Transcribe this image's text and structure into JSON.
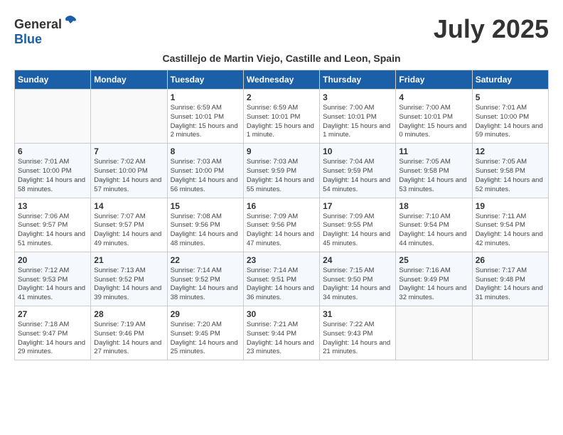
{
  "header": {
    "logo_general": "General",
    "logo_blue": "Blue",
    "month_title": "July 2025",
    "subtitle": "Castillejo de Martin Viejo, Castille and Leon, Spain"
  },
  "weekdays": [
    "Sunday",
    "Monday",
    "Tuesday",
    "Wednesday",
    "Thursday",
    "Friday",
    "Saturday"
  ],
  "weeks": [
    [
      {
        "day": "",
        "sunrise": "",
        "sunset": "",
        "daylight": ""
      },
      {
        "day": "",
        "sunrise": "",
        "sunset": "",
        "daylight": ""
      },
      {
        "day": "1",
        "sunrise": "Sunrise: 6:59 AM",
        "sunset": "Sunset: 10:01 PM",
        "daylight": "Daylight: 15 hours and 2 minutes."
      },
      {
        "day": "2",
        "sunrise": "Sunrise: 6:59 AM",
        "sunset": "Sunset: 10:01 PM",
        "daylight": "Daylight: 15 hours and 1 minute."
      },
      {
        "day": "3",
        "sunrise": "Sunrise: 7:00 AM",
        "sunset": "Sunset: 10:01 PM",
        "daylight": "Daylight: 15 hours and 1 minute."
      },
      {
        "day": "4",
        "sunrise": "Sunrise: 7:00 AM",
        "sunset": "Sunset: 10:01 PM",
        "daylight": "Daylight: 15 hours and 0 minutes."
      },
      {
        "day": "5",
        "sunrise": "Sunrise: 7:01 AM",
        "sunset": "Sunset: 10:00 PM",
        "daylight": "Daylight: 14 hours and 59 minutes."
      }
    ],
    [
      {
        "day": "6",
        "sunrise": "Sunrise: 7:01 AM",
        "sunset": "Sunset: 10:00 PM",
        "daylight": "Daylight: 14 hours and 58 minutes."
      },
      {
        "day": "7",
        "sunrise": "Sunrise: 7:02 AM",
        "sunset": "Sunset: 10:00 PM",
        "daylight": "Daylight: 14 hours and 57 minutes."
      },
      {
        "day": "8",
        "sunrise": "Sunrise: 7:03 AM",
        "sunset": "Sunset: 10:00 PM",
        "daylight": "Daylight: 14 hours and 56 minutes."
      },
      {
        "day": "9",
        "sunrise": "Sunrise: 7:03 AM",
        "sunset": "Sunset: 9:59 PM",
        "daylight": "Daylight: 14 hours and 55 minutes."
      },
      {
        "day": "10",
        "sunrise": "Sunrise: 7:04 AM",
        "sunset": "Sunset: 9:59 PM",
        "daylight": "Daylight: 14 hours and 54 minutes."
      },
      {
        "day": "11",
        "sunrise": "Sunrise: 7:05 AM",
        "sunset": "Sunset: 9:58 PM",
        "daylight": "Daylight: 14 hours and 53 minutes."
      },
      {
        "day": "12",
        "sunrise": "Sunrise: 7:05 AM",
        "sunset": "Sunset: 9:58 PM",
        "daylight": "Daylight: 14 hours and 52 minutes."
      }
    ],
    [
      {
        "day": "13",
        "sunrise": "Sunrise: 7:06 AM",
        "sunset": "Sunset: 9:57 PM",
        "daylight": "Daylight: 14 hours and 51 minutes."
      },
      {
        "day": "14",
        "sunrise": "Sunrise: 7:07 AM",
        "sunset": "Sunset: 9:57 PM",
        "daylight": "Daylight: 14 hours and 49 minutes."
      },
      {
        "day": "15",
        "sunrise": "Sunrise: 7:08 AM",
        "sunset": "Sunset: 9:56 PM",
        "daylight": "Daylight: 14 hours and 48 minutes."
      },
      {
        "day": "16",
        "sunrise": "Sunrise: 7:09 AM",
        "sunset": "Sunset: 9:56 PM",
        "daylight": "Daylight: 14 hours and 47 minutes."
      },
      {
        "day": "17",
        "sunrise": "Sunrise: 7:09 AM",
        "sunset": "Sunset: 9:55 PM",
        "daylight": "Daylight: 14 hours and 45 minutes."
      },
      {
        "day": "18",
        "sunrise": "Sunrise: 7:10 AM",
        "sunset": "Sunset: 9:54 PM",
        "daylight": "Daylight: 14 hours and 44 minutes."
      },
      {
        "day": "19",
        "sunrise": "Sunrise: 7:11 AM",
        "sunset": "Sunset: 9:54 PM",
        "daylight": "Daylight: 14 hours and 42 minutes."
      }
    ],
    [
      {
        "day": "20",
        "sunrise": "Sunrise: 7:12 AM",
        "sunset": "Sunset: 9:53 PM",
        "daylight": "Daylight: 14 hours and 41 minutes."
      },
      {
        "day": "21",
        "sunrise": "Sunrise: 7:13 AM",
        "sunset": "Sunset: 9:52 PM",
        "daylight": "Daylight: 14 hours and 39 minutes."
      },
      {
        "day": "22",
        "sunrise": "Sunrise: 7:14 AM",
        "sunset": "Sunset: 9:52 PM",
        "daylight": "Daylight: 14 hours and 38 minutes."
      },
      {
        "day": "23",
        "sunrise": "Sunrise: 7:14 AM",
        "sunset": "Sunset: 9:51 PM",
        "daylight": "Daylight: 14 hours and 36 minutes."
      },
      {
        "day": "24",
        "sunrise": "Sunrise: 7:15 AM",
        "sunset": "Sunset: 9:50 PM",
        "daylight": "Daylight: 14 hours and 34 minutes."
      },
      {
        "day": "25",
        "sunrise": "Sunrise: 7:16 AM",
        "sunset": "Sunset: 9:49 PM",
        "daylight": "Daylight: 14 hours and 32 minutes."
      },
      {
        "day": "26",
        "sunrise": "Sunrise: 7:17 AM",
        "sunset": "Sunset: 9:48 PM",
        "daylight": "Daylight: 14 hours and 31 minutes."
      }
    ],
    [
      {
        "day": "27",
        "sunrise": "Sunrise: 7:18 AM",
        "sunset": "Sunset: 9:47 PM",
        "daylight": "Daylight: 14 hours and 29 minutes."
      },
      {
        "day": "28",
        "sunrise": "Sunrise: 7:19 AM",
        "sunset": "Sunset: 9:46 PM",
        "daylight": "Daylight: 14 hours and 27 minutes."
      },
      {
        "day": "29",
        "sunrise": "Sunrise: 7:20 AM",
        "sunset": "Sunset: 9:45 PM",
        "daylight": "Daylight: 14 hours and 25 minutes."
      },
      {
        "day": "30",
        "sunrise": "Sunrise: 7:21 AM",
        "sunset": "Sunset: 9:44 PM",
        "daylight": "Daylight: 14 hours and 23 minutes."
      },
      {
        "day": "31",
        "sunrise": "Sunrise: 7:22 AM",
        "sunset": "Sunset: 9:43 PM",
        "daylight": "Daylight: 14 hours and 21 minutes."
      },
      {
        "day": "",
        "sunrise": "",
        "sunset": "",
        "daylight": ""
      },
      {
        "day": "",
        "sunrise": "",
        "sunset": "",
        "daylight": ""
      }
    ]
  ]
}
